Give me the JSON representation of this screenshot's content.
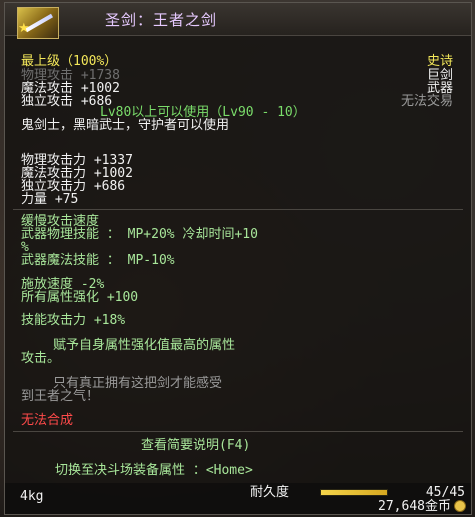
{
  "item": {
    "name": "圣剑：王者之剑",
    "icon": "sword-icon",
    "star_icon": "star-icon"
  },
  "header": {
    "grade": "最上级（100%）",
    "rarity": "史诗",
    "faded_attack": "物理攻击 +1738",
    "category": "巨剑",
    "magic_attack": "魔法攻击 +1002",
    "type": "武器",
    "indep_attack": "独立攻击 +686",
    "trade": "无法交易",
    "level_req": "Lv80以上可以使用（Lv90 - 10）",
    "class_req": "鬼剑士，黑暗武士，守护者可以使用"
  },
  "stats": {
    "phys": "物理攻击力 +1337",
    "magic": "魔法攻击力 +1002",
    "indep": "独立攻击力 +686",
    "str": "力量 +75"
  },
  "effects": {
    "slow_speed": "缓慢攻击速度",
    "phys_skill": "武器物理技能 ： MP+20% 冷却时间+10",
    "phys_skill_cont": "%",
    "magic_skill": "武器魔法技能 ： MP-10%",
    "cast_speed": "施放速度 -2%",
    "elem": "所有属性强化 +100",
    "skill_atk": "技能攻击力 +18%",
    "elem_desc_1": "赋予自身属性强化值最高的属性",
    "elem_desc_2": "攻击。",
    "flavor_1": "只有真正拥有这把剑才能感受",
    "flavor_2": "到王者之气！"
  },
  "status": {
    "no_fusion": "无法合成"
  },
  "actions": {
    "summary": "查看简要说明(F4)",
    "switch": "切换至决斗场装备属性 ：<Home>"
  },
  "footer": {
    "weight": "4kg",
    "durability_label": "耐久度",
    "durability_value": "45/45",
    "durability_fraction": 1.0,
    "price": "27,648金币"
  },
  "colors": {
    "rarity": "#f4e85a",
    "name": "#e6c9ff",
    "no_fusion": "#ff4a4a",
    "action": "#a8e69a"
  }
}
